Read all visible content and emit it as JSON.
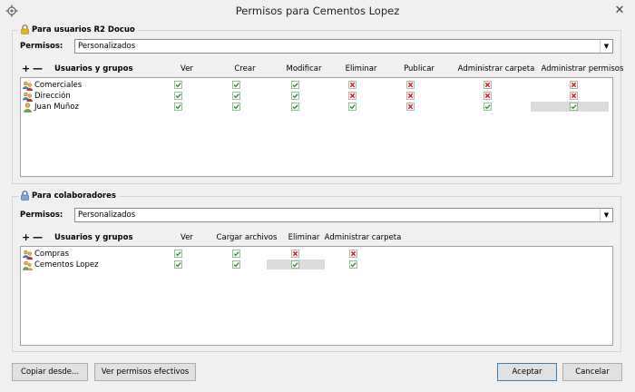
{
  "window": {
    "title": "Permisos para Cementos Lopez",
    "close_glyph": "✕"
  },
  "r2_section": {
    "title": "Para usuarios R2 Docuo",
    "perm_label": "Permisos:",
    "perm_value": "Personalizados",
    "add_glyph": "+",
    "remove_glyph": "—",
    "users_header": "Usuarios y grupos",
    "columns": [
      "Ver",
      "Crear",
      "Modificar",
      "Eliminar",
      "Publicar",
      "Administrar carpeta",
      "Administrar permisos"
    ],
    "rows": [
      {
        "name": "Comerciales",
        "icon": "group-icon",
        "perms": [
          true,
          true,
          true,
          false,
          false,
          false,
          false
        ]
      },
      {
        "name": "Dirección",
        "icon": "group-icon",
        "perms": [
          true,
          true,
          true,
          false,
          false,
          false,
          false
        ]
      },
      {
        "name": "Juan Muñoz",
        "icon": "user-icon",
        "perms": [
          true,
          true,
          true,
          true,
          false,
          true,
          true
        ]
      }
    ]
  },
  "collab_section": {
    "title": "Para colaboradores",
    "perm_label": "Permisos:",
    "perm_value": "Personalizados",
    "add_glyph": "+",
    "remove_glyph": "—",
    "users_header": "Usuarios y grupos",
    "columns": [
      "Ver",
      "Cargar archivos",
      "Eliminar",
      "Administrar carpeta"
    ],
    "rows": [
      {
        "name": "Compras",
        "icon": "group-icon",
        "perms": [
          true,
          true,
          false,
          false
        ]
      },
      {
        "name": "Cementos Lopez",
        "icon": "user-group-icon",
        "perms": [
          true,
          true,
          true,
          true
        ]
      }
    ]
  },
  "buttons": {
    "copy_from": "Copiar desde...",
    "effective": "Ver permisos efectivos",
    "accept": "Aceptar",
    "cancel": "Cancelar"
  },
  "colors": {
    "check": "#2a9a2a",
    "cross": "#d21a1a",
    "accent_border": "#3c7fb1"
  }
}
